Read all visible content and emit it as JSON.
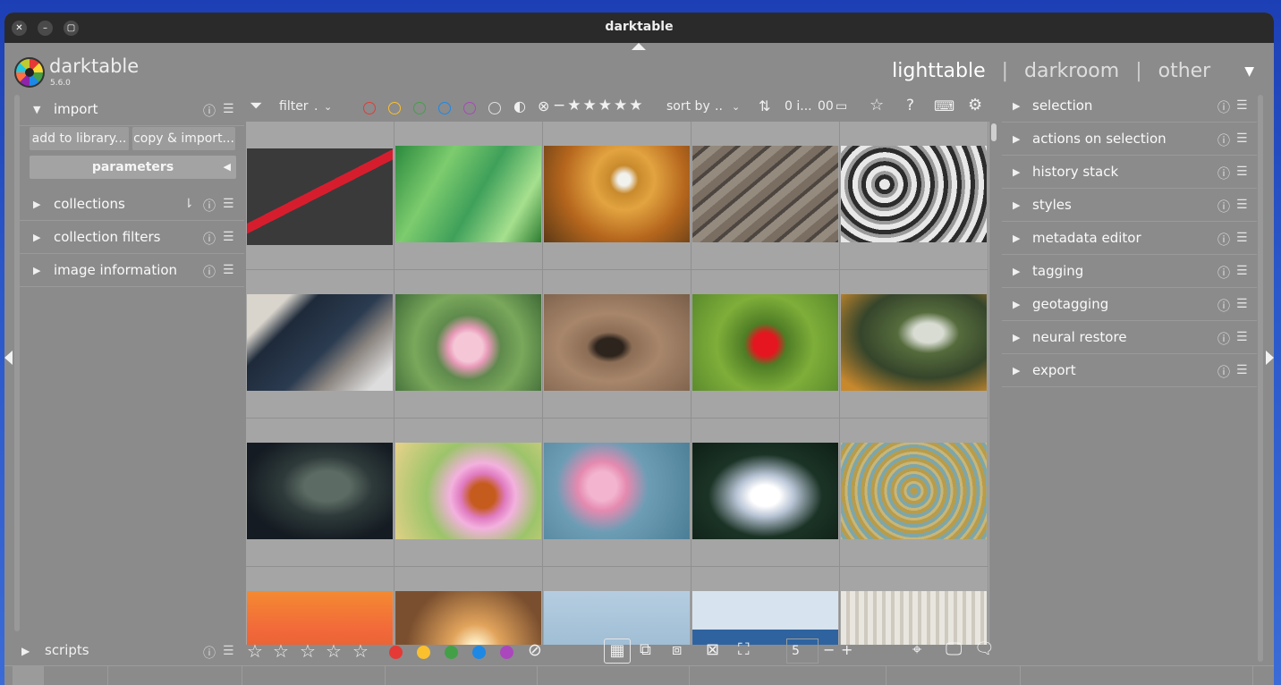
{
  "window": {
    "title": "darktable"
  },
  "header": {
    "app_name": "darktable",
    "version": "5.6.0",
    "views": [
      "lighttable",
      "darkroom",
      "other"
    ],
    "view_separator": "|",
    "active_view": "lighttable"
  },
  "left_panel": {
    "modules": [
      {
        "label": "import",
        "expanded": true
      },
      {
        "label": "collections",
        "expanded": false
      },
      {
        "label": "collection filters",
        "expanded": false
      },
      {
        "label": "image information",
        "expanded": false
      }
    ],
    "import_buttons": [
      "add to library...",
      "copy & import..."
    ],
    "parameters_label": "parameters",
    "bottom_module": "scripts"
  },
  "filter_bar": {
    "filter_label": "filter",
    "filter_value": ".",
    "sort_label": "sort by",
    "sort_value": "..",
    "count_label": "0 i...",
    "count2_label": "00"
  },
  "color_labels": [
    "#e53935",
    "#fbc02d",
    "#43a047",
    "#1e88e5",
    "#ab47bc"
  ],
  "right_panel": {
    "modules": [
      "selection",
      "actions on selection",
      "history stack",
      "styles",
      "metadata editor",
      "tagging",
      "geotagging",
      "neural restore",
      "export"
    ]
  },
  "bottom_bar": {
    "zoom_value": "5",
    "minus_label": "−",
    "plus_label": "+"
  },
  "icons": [
    "close-icon",
    "minimize-icon",
    "maximize-icon",
    "funnel-icon",
    "star-icon",
    "help-icon",
    "keyboard-icon",
    "gear-icon",
    "sort-order-icon",
    "grid-icon",
    "culling-icon",
    "preview-icon",
    "focus-peaking-icon",
    "display-icon",
    "chat-icon"
  ]
}
